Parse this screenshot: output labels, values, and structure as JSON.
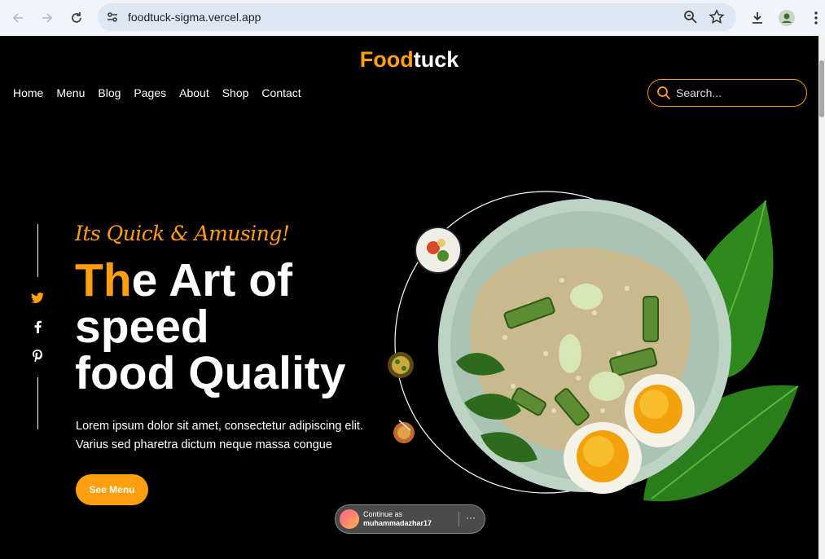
{
  "browser": {
    "url": "foodtuck-sigma.vercel.app"
  },
  "site": {
    "logo_accent": "Food",
    "logo_rest": "tuck",
    "nav": [
      "Home",
      "Menu",
      "Blog",
      "Pages",
      "About",
      "Shop",
      "Contact"
    ],
    "search_placeholder": "Search..."
  },
  "hero": {
    "tagline": "Its Quick & Amusing!",
    "headline_accent": "Th",
    "headline_line1_rest": "e Art of",
    "headline_line2": "speed",
    "headline_line3": "food Quality",
    "description": "Lorem ipsum dolor sit amet, consectetur adipiscing elit. Varius sed pharetra dictum neque massa congue",
    "cta_label": "See Menu"
  },
  "social": [
    "twitter-icon",
    "facebook-icon",
    "pinterest-icon"
  ],
  "onetap": {
    "line1": "Continue as",
    "line2": "muhammadazhar17",
    "more": "···"
  },
  "colors": {
    "accent": "#ff9f0d",
    "background": "#000000",
    "plate": "#bcd3c6",
    "leaf": "#2f8a1e"
  }
}
